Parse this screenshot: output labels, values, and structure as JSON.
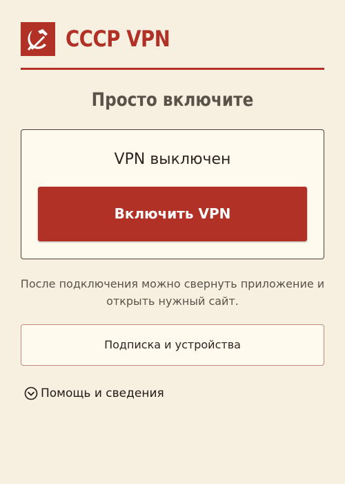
{
  "app": {
    "brand": "СССР VPN",
    "logo_icon": "hammer-sickle-icon"
  },
  "main": {
    "headline": "Просто включите",
    "status": "VPN выключен",
    "connect_label": "Включить VPN",
    "hint": "После подключения можно свернуть приложение и открыть нужный сайт.",
    "subscription_label": "Подписка и устройства",
    "help_label": "Помощь и сведения",
    "help_icon": "chevron-down-circle-icon"
  },
  "colors": {
    "accent": "#b23127",
    "background": "#f7efe0",
    "card": "#fff9ee",
    "muted_text": "#5a5248"
  }
}
